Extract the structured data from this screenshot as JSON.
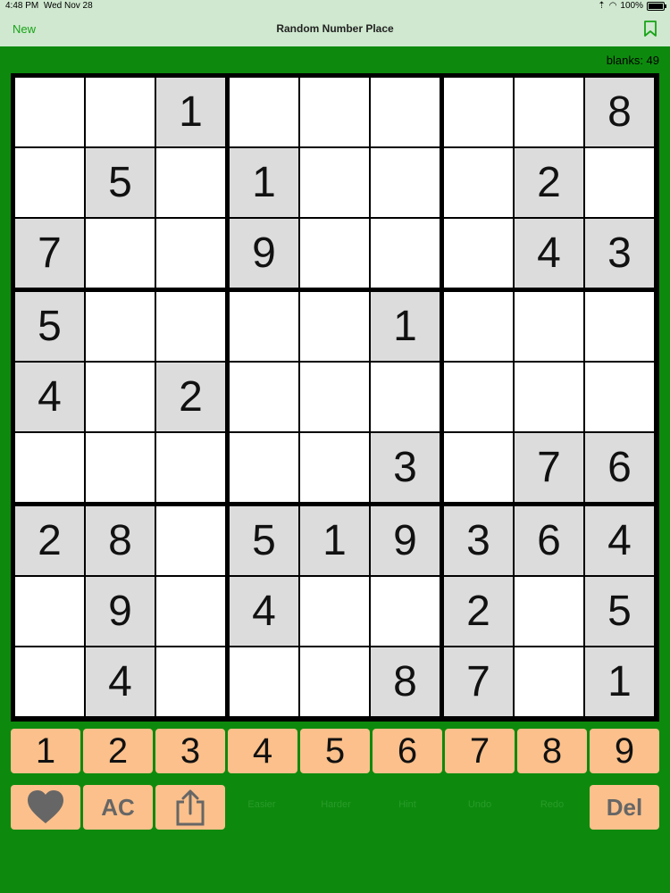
{
  "status_bar": {
    "time": "4:48 PM",
    "date": "Wed Nov 28",
    "battery": "100%",
    "battery_level": 1.0
  },
  "nav": {
    "left_label": "New",
    "title": "Random Number Place",
    "bookmark_icon": "bookmark-icon"
  },
  "blanks_label": "blanks: 49",
  "grid": [
    [
      "",
      "",
      "1",
      "",
      "",
      "",
      "",
      "",
      "8"
    ],
    [
      "",
      "5",
      "",
      "1",
      "",
      "",
      "",
      "2",
      ""
    ],
    [
      "7",
      "",
      "",
      "9",
      "",
      "",
      "",
      "4",
      "3"
    ],
    [
      "5",
      "",
      "",
      "",
      "",
      "1",
      "",
      "",
      ""
    ],
    [
      "4",
      "",
      "2",
      "",
      "",
      "",
      "",
      "",
      ""
    ],
    [
      "",
      "",
      "",
      "",
      "",
      "3",
      "",
      "7",
      "6"
    ],
    [
      "2",
      "8",
      "",
      "5",
      "1",
      "9",
      "3",
      "6",
      "4"
    ],
    [
      "",
      "9",
      "",
      "4",
      "",
      "",
      "2",
      "",
      "5"
    ],
    [
      "",
      "4",
      "",
      "",
      "",
      "8",
      "7",
      "",
      "1"
    ]
  ],
  "number_pad": [
    "1",
    "2",
    "3",
    "4",
    "5",
    "6",
    "7",
    "8",
    "9"
  ],
  "toolbar": {
    "heart_icon": "heart-icon",
    "clear_label": "AC",
    "share_icon": "share-icon",
    "faint_labels": [
      "Easier",
      "Harder",
      "Hint",
      "Undo",
      "Redo"
    ],
    "delete_label": "Del"
  },
  "colors": {
    "background": "#0d8a0d",
    "header": "#cfe8cf",
    "accent": "#17a317",
    "given_cell": "#dcdcdc",
    "button": "#fbc08b"
  }
}
